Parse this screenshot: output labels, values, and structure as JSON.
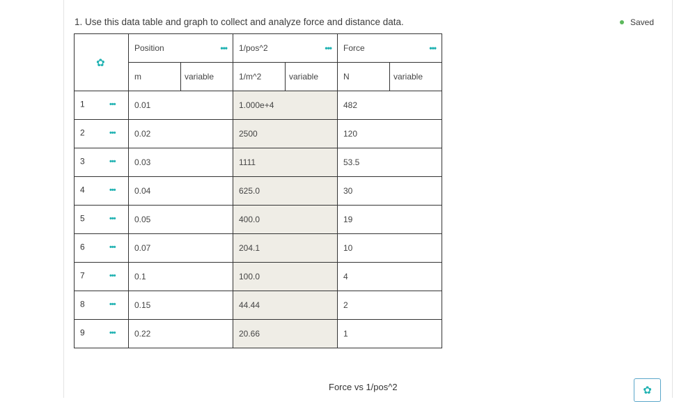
{
  "question": "1. Use this data table and graph to collect and analyze force and distance data.",
  "status": "Saved",
  "table": {
    "columns": [
      {
        "name": "Position",
        "unit": "m",
        "type": "variable",
        "shaded": false
      },
      {
        "name": "1/pos^2",
        "unit": "1/m^2",
        "type": "variable",
        "shaded": true
      },
      {
        "name": "Force",
        "unit": "N",
        "type": "variable",
        "shaded": false
      }
    ],
    "rows": [
      {
        "index": "1",
        "position": "0.01",
        "inv_pos2": "1.000e+4",
        "force": "482"
      },
      {
        "index": "2",
        "position": "0.02",
        "inv_pos2": "2500",
        "force": "120"
      },
      {
        "index": "3",
        "position": "0.03",
        "inv_pos2": "1111",
        "force": "53.5"
      },
      {
        "index": "4",
        "position": "0.04",
        "inv_pos2": "625.0",
        "force": "30"
      },
      {
        "index": "5",
        "position": "0.05",
        "inv_pos2": "400.0",
        "force": "19"
      },
      {
        "index": "6",
        "position": "0.07",
        "inv_pos2": "204.1",
        "force": "10"
      },
      {
        "index": "7",
        "position": "0.1",
        "inv_pos2": "100.0",
        "force": "4"
      },
      {
        "index": "8",
        "position": "0.15",
        "inv_pos2": "44.44",
        "force": "2"
      },
      {
        "index": "9",
        "position": "0.22",
        "inv_pos2": "20.66",
        "force": "1"
      }
    ]
  },
  "graph": {
    "title": "Force vs 1/pos^2"
  },
  "icons": {
    "settings": "gear-icon",
    "menu": "ellipsis-icon"
  },
  "colors": {
    "accent": "#20b2b2",
    "saved_dot": "#5cb85c",
    "shaded_cell": "#efede6"
  }
}
